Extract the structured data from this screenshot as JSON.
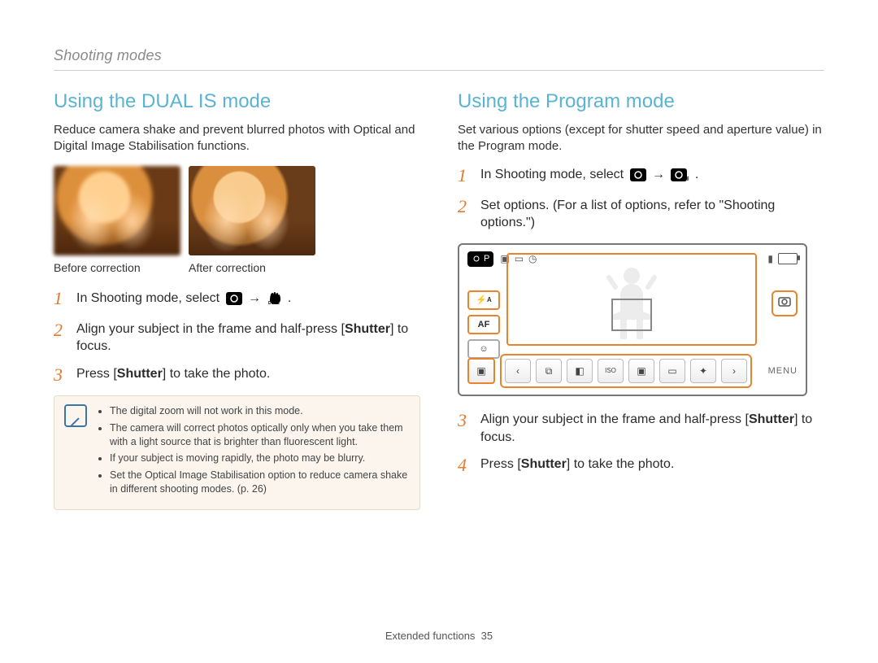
{
  "header": {
    "section": "Shooting modes"
  },
  "left": {
    "title": "Using the DUAL IS mode",
    "lead": "Reduce camera shake and prevent blurred photos with Optical and Digital Image Stabilisation functions.",
    "caption_before": "Before correction",
    "caption_after": "After correction",
    "step1_pre": "In Shooting mode, select ",
    "step1_post": ".",
    "step2_a": "Align your subject in the frame and half-press [",
    "step2_b": "Shutter",
    "step2_c": "] to focus.",
    "step3_a": "Press [",
    "step3_b": "Shutter",
    "step3_c": "] to take the photo.",
    "tips": [
      "The digital zoom will not work in this mode.",
      "The camera will correct photos optically only when you take them with a light source that is brighter than fluorescent light.",
      "If your subject is moving rapidly, the photo may be blurry.",
      "Set the Optical Image Stabilisation option to reduce camera shake in different shooting modes. (p. 26)"
    ]
  },
  "right": {
    "title": "Using the Program mode",
    "lead": "Set various options (except for shutter speed and aperture value) in the Program mode.",
    "step1_pre": "In Shooting mode, select ",
    "step1_post": ".",
    "step2": "Set options. (For a list of options, refer to \"Shooting options.\")",
    "step3_a": "Align your subject in the frame and half-press [",
    "step3_b": "Shutter",
    "step3_c": "] to focus.",
    "step4_a": "Press [",
    "step4_b": "Shutter",
    "step4_c": "] to take the photo.",
    "screen": {
      "mode_label": "P",
      "af_label": "AF",
      "flash_label": "A",
      "menu_label": "MENU"
    }
  },
  "footer": {
    "label": "Extended functions",
    "page": "35"
  },
  "icons": {
    "arrow": "→"
  }
}
